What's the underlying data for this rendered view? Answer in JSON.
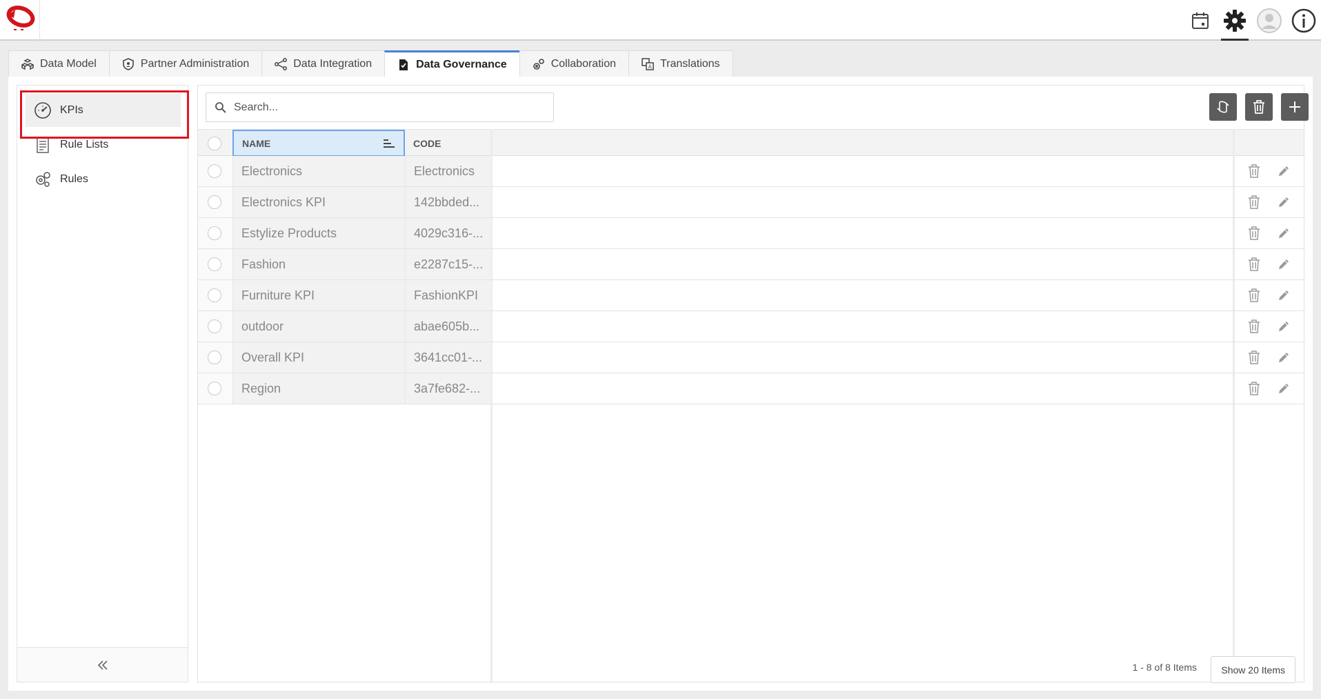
{
  "header": {
    "icons": [
      "calendar-icon",
      "gear-icon",
      "user-avatar-icon",
      "info-icon"
    ]
  },
  "tabs": [
    {
      "label": "Data Model",
      "icon": "cubes-icon"
    },
    {
      "label": "Partner Administration",
      "icon": "shield-icon"
    },
    {
      "label": "Data Integration",
      "icon": "share-nodes-icon"
    },
    {
      "label": "Data Governance",
      "icon": "document-check-icon",
      "active": true
    },
    {
      "label": "Collaboration",
      "icon": "gears-icon"
    },
    {
      "label": "Translations",
      "icon": "translate-icon"
    }
  ],
  "sidebar": {
    "items": [
      {
        "label": "KPIs",
        "icon": "gauge-icon",
        "active": true
      },
      {
        "label": "Rule Lists",
        "icon": "list-document-icon"
      },
      {
        "label": "Rules",
        "icon": "cog-rules-icon"
      }
    ],
    "collapse_icon": "double-chevron-left-icon"
  },
  "search": {
    "placeholder": "Search..."
  },
  "toolbar": {
    "buttons": [
      "sync-icon",
      "trash-icon",
      "plus-icon"
    ]
  },
  "table": {
    "columns": {
      "name": "NAME",
      "code": "CODE"
    },
    "rows": [
      {
        "name": "Electronics",
        "code": "Electronics"
      },
      {
        "name": "Electronics KPI",
        "code": "142bbded..."
      },
      {
        "name": "Estylize Products",
        "code": "4029c316-..."
      },
      {
        "name": "Fashion",
        "code": "e2287c15-..."
      },
      {
        "name": "Furniture KPI",
        "code": "FashionKPI"
      },
      {
        "name": "outdoor",
        "code": "abae605b..."
      },
      {
        "name": "Overall KPI",
        "code": "3641cc01-..."
      },
      {
        "name": "Region",
        "code": "3a7fe682-..."
      }
    ]
  },
  "pager": {
    "info": "1 - 8 of 8 Items",
    "page_size_label": "Show 20 Items"
  }
}
